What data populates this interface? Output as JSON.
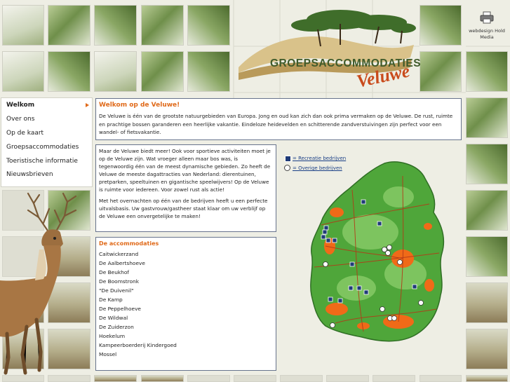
{
  "header": {
    "logo_title": "GROEPSACCOMMODATIES",
    "logo_subtitle": "Veluwe",
    "print_label": "webdesign Hold Media",
    "print_icon": "printer-icon"
  },
  "nav": {
    "items": [
      {
        "label": "Welkom",
        "active": true
      },
      {
        "label": "Over ons"
      },
      {
        "label": "Op de kaart"
      },
      {
        "label": "Groepsaccommodaties"
      },
      {
        "label": "Toeristische informatie"
      },
      {
        "label": "Nieuwsbrieven"
      }
    ]
  },
  "welcome": {
    "title": "Welkom op de Veluwe!",
    "text": "De Veluwe is één van de grootste natuurgebieden van Europa. Jong en oud kan zich dan ook prima vermaken op de Veluwe. De rust, ruimte en prachtige bossen garanderen een heerlijke vakantie. Eindeloze heidevelden en schitterende zandverstuivingen zijn perfect voor een wandel- of fietsvakantie."
  },
  "intro": {
    "p1": "Maar de Veluwe biedt meer! Ook voor sportieve activiteiten moet je op de Veluwe zijn. Wat vroeger alleen maar bos was, is tegenwoordig één van de meest dynamische gebieden. Zo heeft de Veluwe de meeste dagattracties van Nederland: dierentuinen, pretparken, speeltuinen en gigantische speelwijvers! Op de Veluwe is ruimte voor iedereen. Voor zowel rust als actie!",
    "p2": "Met het overnachten op één van de bedrijven heeft u een perfecte uitvalsbasis. Uw gastvrouw/gastheer staat klaar om uw verblijf op de Veluwe een onvergetelijke te maken!"
  },
  "accommodations": {
    "title": "De accommodaties",
    "items": [
      "Caitwickerzand",
      "De Aalbertshoeve",
      "De Beukhof",
      "De Boomstronk",
      "\"De Duivenil\"",
      "De Kamp",
      "De Peppelhoeve",
      "De Wildwal",
      "De Zuiderzon",
      "Hoekelum",
      "Kampeerboerderij Kindergoed",
      "Mossel"
    ]
  },
  "map": {
    "legend_recreation": "= Recreatie bedrijven",
    "legend_other": "= Overige bedrijven",
    "land_color": "#4fa63a",
    "city_color": "#f06a18",
    "marker_square_color": "#1f3b78"
  }
}
